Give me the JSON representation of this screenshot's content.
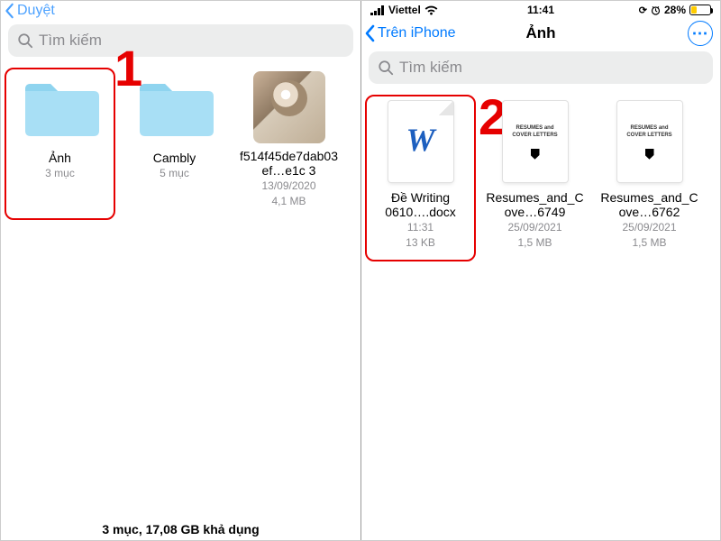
{
  "left": {
    "nav_back_label": "Duyệt",
    "search_placeholder": "Tìm kiếm",
    "annotation_number": "1",
    "items": [
      {
        "name": "Ảnh",
        "sub1": "3 mục",
        "sub2": "",
        "type": "folder",
        "highlight": true
      },
      {
        "name": "Cambly",
        "sub1": "5 mục",
        "sub2": "",
        "type": "folder",
        "highlight": false
      },
      {
        "name": "f514f45de7dab03ef…e1c 3",
        "sub1": "13/09/2020",
        "sub2": "4,1 MB",
        "type": "photo",
        "highlight": false
      }
    ],
    "footer": "3 mục, 17,08 GB khả dụng"
  },
  "right": {
    "status": {
      "carrier": "Viettel",
      "time": "11:41",
      "battery_pct": "28%",
      "battery_fill_pct": 28
    },
    "nav_back_label": "Trên iPhone",
    "nav_title": "Ảnh",
    "search_placeholder": "Tìm kiếm",
    "annotation_number": "2",
    "items": [
      {
        "name": "Đề Writing 0610….docx",
        "sub1": "11:31",
        "sub2": "13 KB",
        "type": "docx",
        "highlight": true
      },
      {
        "name": "Resumes_and_Cove…6749",
        "sub1": "25/09/2021",
        "sub2": "1,5 MB",
        "type": "pdf",
        "pdf_title": "RESUMES and COVER LETTERS",
        "highlight": false
      },
      {
        "name": "Resumes_and_Cove…6762",
        "sub1": "25/09/2021",
        "sub2": "1,5 MB",
        "type": "pdf",
        "pdf_title": "RESUMES and COVER LETTERS",
        "highlight": false
      }
    ]
  }
}
